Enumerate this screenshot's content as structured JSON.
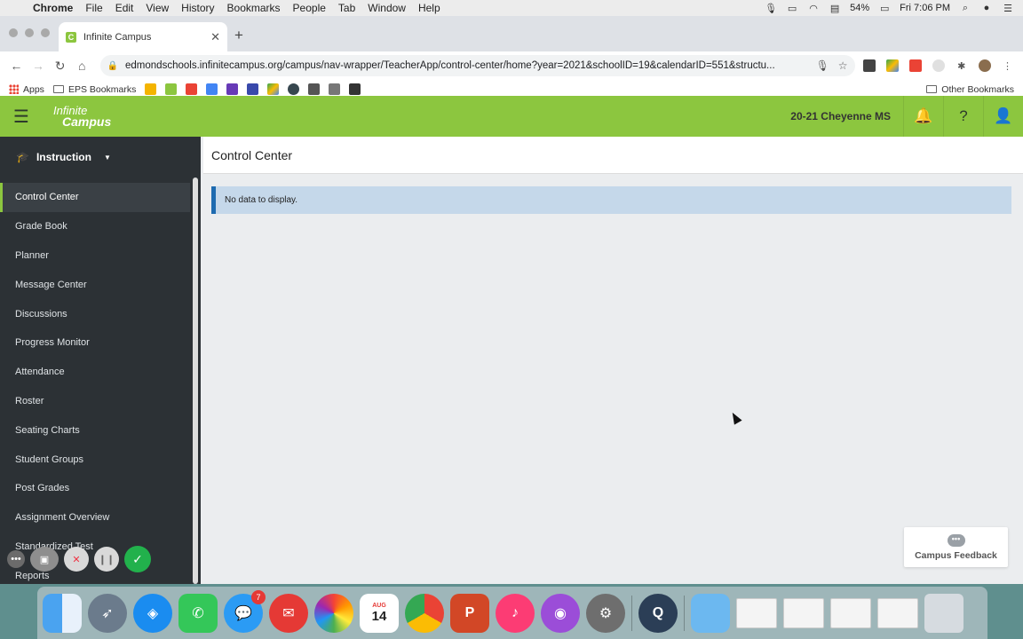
{
  "menubar": {
    "app": "Chrome",
    "items": [
      "File",
      "Edit",
      "View",
      "History",
      "Bookmarks",
      "People",
      "Tab",
      "Window",
      "Help"
    ],
    "battery": "54%",
    "clock": "Fri 7:06 PM"
  },
  "browser": {
    "tab_title": "Infinite Campus",
    "url": "edmondschools.infinitecampus.org/campus/nav-wrapper/TeacherApp/control-center/home?year=2021&schoolID=19&calendarID=551&structu...",
    "bookmarks": {
      "apps": "Apps",
      "eps": "EPS Bookmarks",
      "other": "Other Bookmarks"
    }
  },
  "app": {
    "logo_line1": "Infinite",
    "logo_line2": "Campus",
    "school": "20-21 Cheyenne MS",
    "section": "Instruction",
    "nav_items": [
      "Control Center",
      "Grade Book",
      "Planner",
      "Message Center",
      "Discussions",
      "Progress Monitor",
      "Attendance",
      "Roster",
      "Seating Charts",
      "Student Groups",
      "Post Grades",
      "Assignment Overview",
      "Standardized Test",
      "Reports"
    ],
    "page_title": "Control Center",
    "notice": "No data to display.",
    "feedback_label": "Campus Feedback"
  },
  "dock": {
    "messages_badge": "7",
    "calendar_month": "AUG",
    "calendar_day": "14",
    "ppt_letter": "P"
  },
  "colors": {
    "brand_green": "#8cc63f",
    "sidebar_bg": "#2c3135",
    "notice_bg": "#c5d8ea",
    "notice_accent": "#1e6bb0"
  }
}
